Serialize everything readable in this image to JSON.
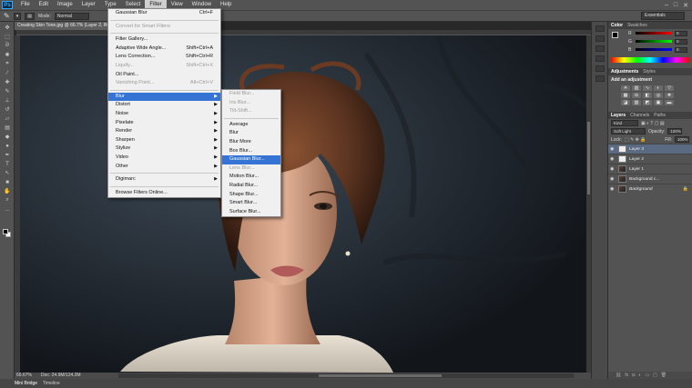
{
  "app": {
    "logo": "Ps"
  },
  "menubar": {
    "items": [
      "File",
      "Edit",
      "Image",
      "Layer",
      "Type",
      "Select",
      "Filter",
      "View",
      "Window",
      "Help"
    ],
    "active": "Filter",
    "window_controls": [
      "–",
      "□",
      "✕"
    ]
  },
  "options": {
    "mode_label": "Mode:",
    "mode_value": "Normal",
    "workspace": "Essentials"
  },
  "document": {
    "tab_title": "Creating Skin Tone.jpg @ 66.7% (Layer 2, RGB/8)",
    "zoom": "66.67%",
    "doc_info": "Doc: 24.9M/124.2M"
  },
  "bottom_tabs": [
    "Mini Bridge",
    "Timeline"
  ],
  "filter_menu": {
    "items": [
      {
        "label": "Gaussian Blur",
        "shortcut": "Ctrl+F",
        "disabled": false
      },
      {
        "sep": true
      },
      {
        "label": "Convert for Smart Filters",
        "disabled": true
      },
      {
        "sep": true
      },
      {
        "label": "Filter Gallery...",
        "disabled": false
      },
      {
        "label": "Adaptive Wide Angle...",
        "shortcut": "Shift+Ctrl+A",
        "disabled": false
      },
      {
        "label": "Lens Correction...",
        "shortcut": "Shift+Ctrl+R",
        "disabled": false
      },
      {
        "label": "Liquify...",
        "shortcut": "Shift+Ctrl+X",
        "disabled": true
      },
      {
        "label": "Oil Paint...",
        "disabled": false
      },
      {
        "label": "Vanishing Point...",
        "shortcut": "Alt+Ctrl+V",
        "disabled": true
      },
      {
        "sep": true
      },
      {
        "label": "Blur",
        "submenu": true,
        "highlight": true
      },
      {
        "label": "Distort",
        "submenu": true
      },
      {
        "label": "Noise",
        "submenu": true
      },
      {
        "label": "Pixelate",
        "submenu": true
      },
      {
        "label": "Render",
        "submenu": true
      },
      {
        "label": "Sharpen",
        "submenu": true
      },
      {
        "label": "Stylize",
        "submenu": true
      },
      {
        "label": "Video",
        "submenu": true
      },
      {
        "label": "Other",
        "submenu": true
      },
      {
        "sep": true
      },
      {
        "label": "Digimarc",
        "submenu": true
      },
      {
        "sep": true
      },
      {
        "label": "Browse Filters Online..."
      }
    ]
  },
  "blur_submenu": {
    "items": [
      {
        "label": "Field Blur...",
        "disabled": true
      },
      {
        "label": "Iris Blur...",
        "disabled": true
      },
      {
        "label": "Tilt-Shift...",
        "disabled": true
      },
      {
        "sep": true
      },
      {
        "label": "Average"
      },
      {
        "label": "Blur"
      },
      {
        "label": "Blur More"
      },
      {
        "label": "Box Blur..."
      },
      {
        "label": "Gaussian Blur...",
        "highlight": true
      },
      {
        "label": "Lens Blur...",
        "disabled": true
      },
      {
        "label": "Motion Blur..."
      },
      {
        "label": "Radial Blur..."
      },
      {
        "label": "Shape Blur..."
      },
      {
        "label": "Smart Blur..."
      },
      {
        "label": "Surface Blur..."
      }
    ]
  },
  "color_panel": {
    "tabs": [
      "Color",
      "Swatches"
    ],
    "rows": [
      {
        "label": "R",
        "value": "0"
      },
      {
        "label": "G",
        "value": "0"
      },
      {
        "label": "B",
        "value": "0"
      }
    ]
  },
  "adjustments_panel": {
    "tabs": [
      "Adjustments",
      "Styles"
    ],
    "title": "Add an adjustment"
  },
  "layers_panel": {
    "tabs": [
      "Layers",
      "Channels",
      "Paths"
    ],
    "kind": "Kind",
    "blend_mode": "Soft Light",
    "opacity_label": "Opacity:",
    "opacity": "100%",
    "lock_label": "Lock:",
    "fill_label": "Fill:",
    "fill": "100%",
    "layers": [
      {
        "name": "Layer 3",
        "selected": true,
        "thumb": "white"
      },
      {
        "name": "Layer 2",
        "selected": false,
        "thumb": "white"
      },
      {
        "name": "Layer 1",
        "selected": false,
        "thumb": "photo"
      },
      {
        "name": "Background c...",
        "selected": false,
        "thumb": "photo"
      },
      {
        "name": "Background",
        "selected": false,
        "thumb": "photo",
        "italic": true
      }
    ]
  },
  "colors": {
    "menu_highlight": "#3574d4",
    "layer_selected": "#596a82",
    "chrome": "#535353"
  }
}
